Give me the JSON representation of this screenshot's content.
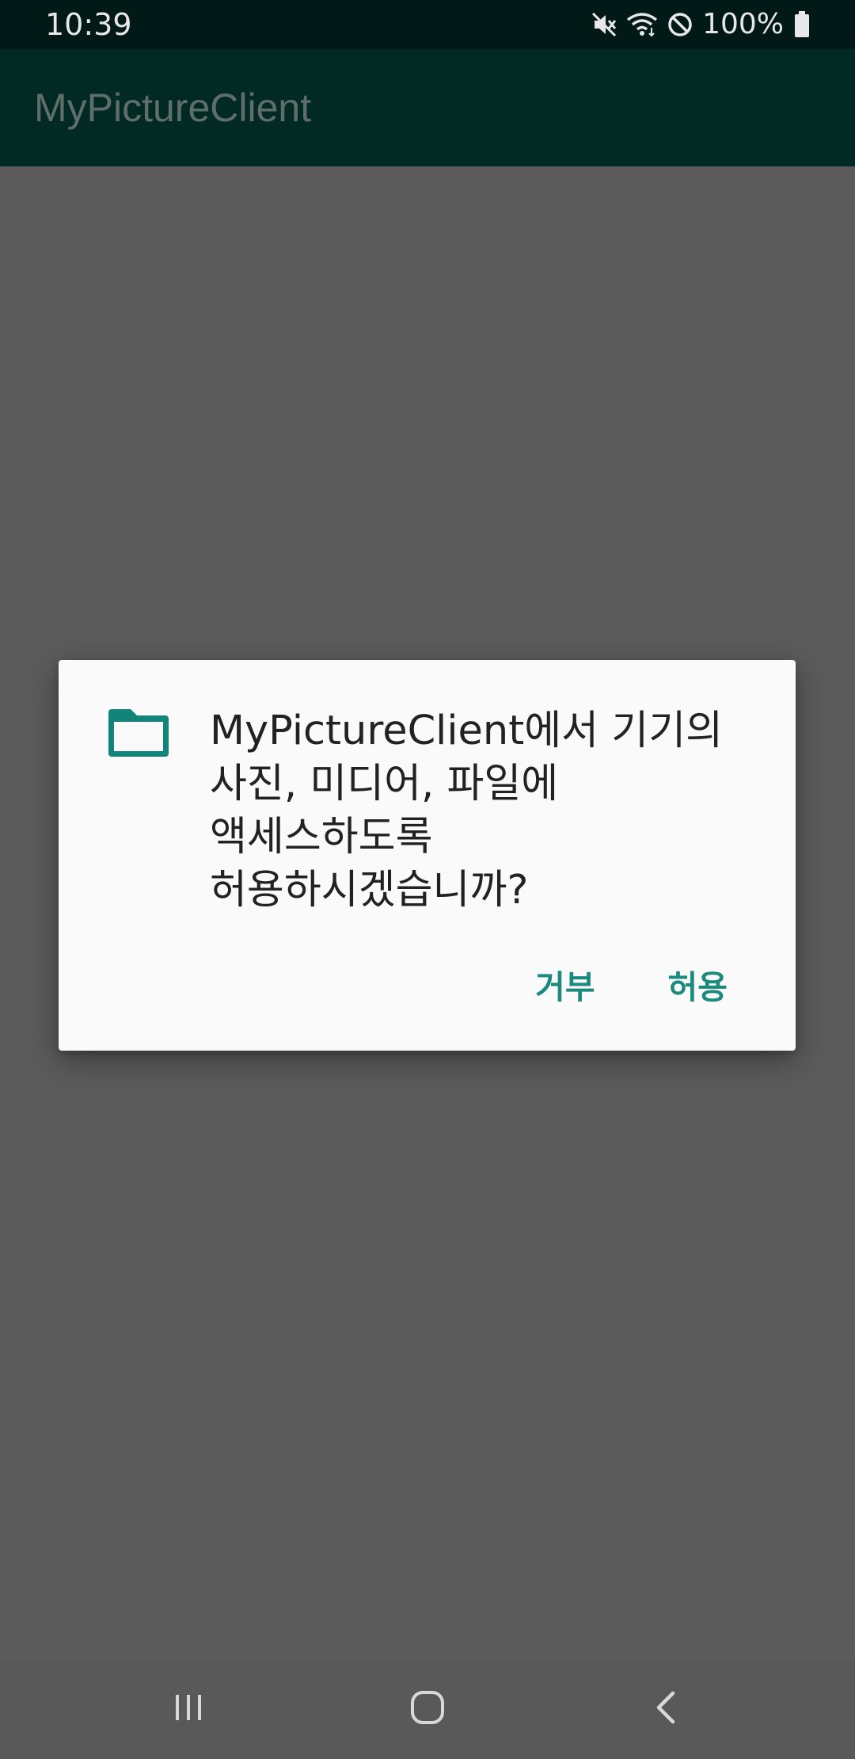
{
  "status_bar": {
    "time": "10:39",
    "battery_percent": "100%",
    "icons": [
      "mute-icon",
      "wifi-icon",
      "do-not-disturb-icon",
      "battery-icon"
    ]
  },
  "app_bar": {
    "title": "MyPictureClient"
  },
  "dialog": {
    "icon": "folder-icon",
    "message": "MyPictureClient에서 기기의\n사진, 미디어, 파일에\n액세스하도록\n허용하시겠습니까?",
    "deny_label": "거부",
    "allow_label": "허용",
    "accent_color": "#1a8a7e"
  },
  "nav_bar": {
    "buttons": [
      "recents-icon",
      "home-icon",
      "back-icon"
    ]
  },
  "colors": {
    "status_bar": "#011a17",
    "app_bar": "#022a25",
    "scrim_background": "#5b5b5b",
    "dialog_background": "#fafafa"
  }
}
